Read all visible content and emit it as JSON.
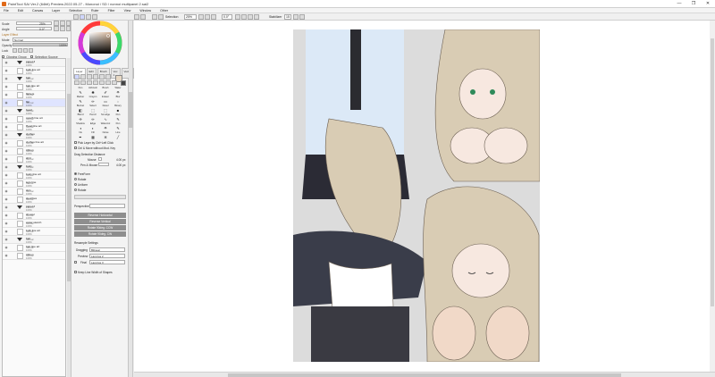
{
  "window": {
    "title": "PaintTool SAI Ver.2 (64bit) Preview.2022.05.27 - Mononoi / SD / nonnoi multipanel 2.sai2",
    "controls": [
      "—",
      "❐",
      "✕"
    ]
  },
  "menu": [
    "File",
    "Edit",
    "Canvas",
    "Layer",
    "Selection",
    "Ruler",
    "Filter",
    "View",
    "Window",
    "Other"
  ],
  "toolbar": {
    "selection_label": "Selection",
    "zoom_value": "25%",
    "angle_value": "0.0°",
    "stabilizer_label": "Stabilizer",
    "stabilizer_value": "15"
  },
  "left_panel": {
    "scale_label": "Scale",
    "scale_value": "25%",
    "angle_label": "Angle",
    "angle_value": "0.0°",
    "layer_effect_label": "Layer Effect",
    "mode_label": "Mode",
    "mode_value": "Normal",
    "opacity_label": "Opacity",
    "opacity_value": "100%",
    "lock_label": "Lock",
    "clipping_group_label": "Clipping Group",
    "selection_source_label": "Selection Source"
  },
  "layers": [
    {
      "type": "folder",
      "name": "panel 3",
      "mode": "Pass-th",
      "opacity": "100%",
      "sel": false
    },
    {
      "type": "layer",
      "name": "bulb line art",
      "mode": "Normal",
      "opacity": "100%",
      "sel": false
    },
    {
      "type": "folder",
      "name": "hair",
      "mode": "Normal",
      "opacity": "100%",
      "sel": false
    },
    {
      "type": "layer",
      "name": "hair line art",
      "mode": "Normal",
      "opacity": "100%",
      "sel": false
    },
    {
      "type": "layer",
      "name": "flatters",
      "mode": "Normal",
      "opacity": "100%",
      "sel": false
    },
    {
      "type": "layer",
      "name": "flat",
      "mode": "Normal",
      "opacity": "100%",
      "sel": true
    },
    {
      "type": "folder",
      "name": "head",
      "mode": "Normal",
      "opacity": "100%",
      "sel": false
    },
    {
      "type": "layer",
      "name": "mouth line art",
      "mode": "Normal",
      "opacity": "100%",
      "sel": false
    },
    {
      "type": "layer",
      "name": "Head line art",
      "mode": "Normal",
      "opacity": "100%",
      "sel": false
    },
    {
      "type": "folder",
      "name": "clothes",
      "mode": "Normal",
      "opacity": "100%",
      "sel": false
    },
    {
      "type": "layer",
      "name": "clothes line art",
      "mode": "Normal",
      "opacity": "100%",
      "sel": false
    },
    {
      "type": "layer",
      "name": "ribbon",
      "mode": "Normal",
      "opacity": "100%",
      "sel": false
    },
    {
      "type": "layer",
      "name": "shirt",
      "mode": "Normal",
      "opacity": "100%",
      "sel": false
    },
    {
      "type": "folder",
      "name": "body",
      "mode": "Normal",
      "opacity": "100%",
      "sel": false
    },
    {
      "type": "layer",
      "name": "body line art",
      "mode": "Normal",
      "opacity": "100%",
      "sel": false
    },
    {
      "type": "layer",
      "name": "legs line",
      "mode": "Normal",
      "opacity": "100%",
      "sel": false
    },
    {
      "type": "layer",
      "name": "skin",
      "mode": "Normal",
      "opacity": "100%",
      "sel": false
    },
    {
      "type": "layer",
      "name": "sketches",
      "mode": "Normal",
      "opacity": "100%",
      "sel": false
    },
    {
      "type": "folder",
      "name": "panel 2",
      "mode": "Pass-th",
      "opacity": "100%",
      "sel": false
    },
    {
      "type": "layer",
      "name": "shower",
      "mode": "Normal",
      "opacity": "100%",
      "sel": false
    },
    {
      "type": "layer",
      "name": "water sketch",
      "mode": "Normal",
      "opacity": "100%",
      "sel": false
    },
    {
      "type": "layer",
      "name": "bulb line art",
      "mode": "Normal",
      "opacity": "100%",
      "sel": false
    },
    {
      "type": "folder",
      "name": "hair",
      "mode": "Normal",
      "opacity": "100%",
      "sel": false
    },
    {
      "type": "layer",
      "name": "hair line art",
      "mode": "Normal",
      "opacity": "100%",
      "sel": false
    },
    {
      "type": "layer",
      "name": "ribbon",
      "mode": "Normal",
      "opacity": "100%",
      "sel": false
    }
  ],
  "mid_panel": {
    "tabs": [
      "Layer",
      "Edit",
      "Brush",
      "Vec 1",
      "Vector"
    ],
    "tools": [
      {
        "label": "Pen",
        "glyph": "✎"
      },
      {
        "label": "Airbrush",
        "glyph": "✺"
      },
      {
        "label": "Brush",
        "glyph": "✐"
      },
      {
        "label": "Water",
        "glyph": "☂"
      },
      {
        "label": "Marker",
        "glyph": "✎"
      },
      {
        "label": "Crayon",
        "glyph": "✏"
      },
      {
        "label": "Eraser",
        "glyph": "▭"
      },
      {
        "label": "Blur",
        "glyph": "◌"
      },
      {
        "label": "Bucket",
        "glyph": "◧"
      },
      {
        "label": "Select",
        "glyph": "⬚"
      },
      {
        "label": "Desel",
        "glyph": "⬚"
      },
      {
        "label": "Binary",
        "glyph": "■"
      },
      {
        "label": "Blend",
        "glyph": "✢"
      },
      {
        "label": "Pencil",
        "glyph": "✏"
      },
      {
        "label": "Smudge",
        "glyph": "∿"
      },
      {
        "label": "Pen",
        "glyph": "✎"
      },
      {
        "label": "Shadow",
        "glyph": "◑"
      },
      {
        "label": "Edge",
        "glyph": "◐"
      },
      {
        "label": "Watercol",
        "glyph": "☂"
      },
      {
        "label": "Pen",
        "glyph": "✎"
      },
      {
        "label": "Ink",
        "glyph": "✒"
      },
      {
        "label": "Fill",
        "glyph": "▦"
      },
      {
        "label": "Noise",
        "glyph": "✲"
      },
      {
        "label": "Line",
        "glyph": "╱"
      }
    ],
    "pick_layer_label": "Pick Layer by Ctrl+Left Click",
    "ctrl_move_label": "Ctrl & Move without Mod. Key",
    "drag_detection_label": "Drag Detection Distance",
    "mouse_label": "Mouse",
    "mouse_value": "4.00 px",
    "pen_label": "Pen & Mouse",
    "pen_value": "4.00 px",
    "transform_options": [
      "FreeForm",
      "Rotate",
      "Uniform",
      "Rotate"
    ],
    "perspective_label": "Perspective",
    "buttons": [
      "Reverse Horizontal",
      "Reverse Vertical",
      "Rotate 90deg. CCW",
      "Rotate 90deg. CW"
    ],
    "resample_label": "Resample Settings",
    "dragging_label": "Dragging",
    "dragging_value": "Bilinear",
    "preview_label": "Preview",
    "preview_value": "Lanczos 2",
    "final_label": "Final",
    "final_value": "Lanczos 3",
    "keep_line_label": "Keep Line Width of Shapes"
  },
  "colors": {
    "accent": "#6a6cff",
    "selected_layer": "#dfe4ff",
    "canvas_bg": "#d9d9d9",
    "hair": "#d9ccb4",
    "skin": "#f7e8e0"
  }
}
